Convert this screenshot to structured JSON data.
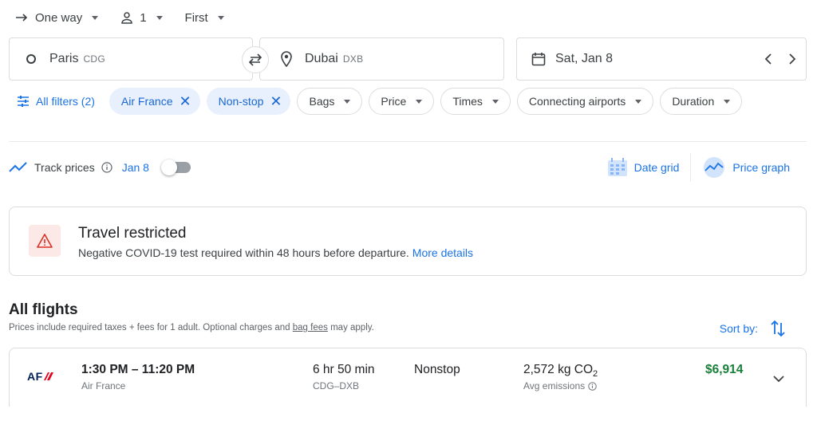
{
  "trip": {
    "type": "One way",
    "passengers": "1",
    "cabin": "First"
  },
  "search": {
    "origin_city": "Paris",
    "origin_code": "CDG",
    "dest_city": "Dubai",
    "dest_code": "DXB",
    "date": "Sat, Jan 8"
  },
  "filters": {
    "all_filters": "All filters (2)",
    "active": [
      {
        "label": "Air France"
      },
      {
        "label": "Non-stop"
      }
    ],
    "dropdowns": [
      {
        "label": "Bags"
      },
      {
        "label": "Price"
      },
      {
        "label": "Times"
      },
      {
        "label": "Connecting airports"
      },
      {
        "label": "Duration"
      }
    ]
  },
  "track": {
    "label": "Track prices",
    "date": "Jan 8"
  },
  "tools": {
    "date_grid": "Date grid",
    "price_graph": "Price graph"
  },
  "alert": {
    "title": "Travel restricted",
    "body": "Negative COVID-19 test required within 48 hours before departure.",
    "link": "More details"
  },
  "flights_section": {
    "title": "All flights",
    "subtitle_pre": "Prices include required taxes + fees for 1 adult. Optional charges and",
    "subtitle_link": "bag fees",
    "subtitle_post": "may apply.",
    "sort_by": "Sort by:"
  },
  "flights": [
    {
      "logo_text": "AF",
      "times": "1:30 PM – 11:20 PM",
      "airline": "Air France",
      "duration": "6 hr 50 min",
      "route": "CDG–DXB",
      "stops": "Nonstop",
      "co2_value": "2,572 kg CO",
      "co2_sub": "2",
      "emissions": "Avg emissions",
      "price": "$6,914"
    }
  ],
  "colors": {
    "accent": "#1a73e8",
    "price_green": "#188038",
    "alert_red": "#d93025"
  }
}
